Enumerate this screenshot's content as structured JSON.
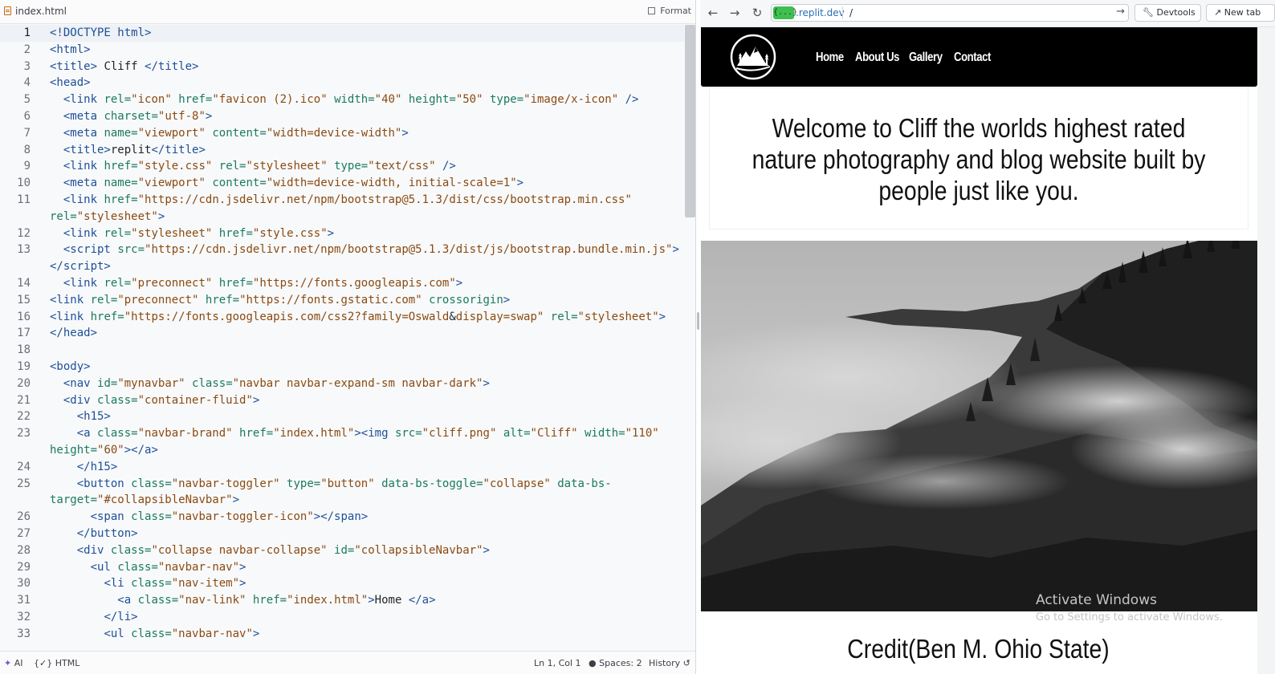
{
  "editor": {
    "tab_title": "index.html",
    "format_label": "Format",
    "lines": [
      {
        "n": "1",
        "html": "<span class='t'>&lt;!DOCTYPE html&gt;</span>"
      },
      {
        "n": "2",
        "html": "<span class='t'>&lt;html&gt;</span>"
      },
      {
        "n": "3",
        "html": "<span class='t'>&lt;title&gt;</span><span class='p'> Cliff </span><span class='t'>&lt;/title&gt;</span>"
      },
      {
        "n": "4",
        "html": "<span class='t'>&lt;head&gt;</span>"
      },
      {
        "n": "5",
        "html": "  <span class='t'>&lt;link</span> <span class='a'>rel=</span><span class='s'>\"icon\"</span> <span class='a'>href=</span><span class='s'>\"favicon (2).ico\"</span> <span class='a'>width=</span><span class='s'>\"40\"</span> <span class='a'>height=</span><span class='s'>\"50\"</span> <span class='a'>type=</span><span class='s'>\"image/x-icon\"</span> <span class='t'>/&gt;</span>"
      },
      {
        "n": "6",
        "html": "  <span class='t'>&lt;meta</span> <span class='a'>charset=</span><span class='s'>\"utf-8\"</span><span class='t'>&gt;</span>"
      },
      {
        "n": "7",
        "html": "  <span class='t'>&lt;meta</span> <span class='a'>name=</span><span class='s'>\"viewport\"</span> <span class='a'>content=</span><span class='s'>\"width=device-width\"</span><span class='t'>&gt;</span>"
      },
      {
        "n": "8",
        "html": "  <span class='t'>&lt;title&gt;</span><span class='p'>replit</span><span class='t'>&lt;/title&gt;</span>"
      },
      {
        "n": "9",
        "html": "  <span class='t'>&lt;link</span> <span class='a'>href=</span><span class='s'>\"style.css\"</span> <span class='a'>rel=</span><span class='s'>\"stylesheet\"</span> <span class='a'>type=</span><span class='s'>\"text/css\"</span> <span class='t'>/&gt;</span>"
      },
      {
        "n": "10",
        "html": "  <span class='t'>&lt;meta</span> <span class='a'>name=</span><span class='s'>\"viewport\"</span> <span class='a'>content=</span><span class='s'>\"width=device-width, initial-scale=1\"</span><span class='t'>&gt;</span>"
      },
      {
        "n": "11",
        "html": "  <span class='t'>&lt;link</span> <span class='a'>href=</span><span class='s'>\"https://cdn.jsdelivr.net/npm/bootstrap@5.1.3/dist/css/bootstrap.min.css\"</span>",
        "wrap": "<span class='a'>rel=</span><span class='s'>\"stylesheet\"</span><span class='t'>&gt;</span>"
      },
      {
        "n": "12",
        "html": "  <span class='t'>&lt;link</span> <span class='a'>rel=</span><span class='s'>\"stylesheet\"</span> <span class='a'>href=</span><span class='s'>\"style.css\"</span><span class='t'>&gt;</span>"
      },
      {
        "n": "13",
        "html": "  <span class='t'>&lt;script</span> <span class='a'>src=</span><span class='s'>\"https://cdn.jsdelivr.net/npm/bootstrap@5.1.3/dist/js/bootstrap.bundle.min.js\"</span><span class='t'>&gt;</span>",
        "wrap": "<span class='t'>&lt;/script&gt;</span>"
      },
      {
        "n": "14",
        "html": "  <span class='t'>&lt;link</span> <span class='a'>rel=</span><span class='s'>\"preconnect\"</span> <span class='a'>href=</span><span class='s'>\"https://fonts.googleapis.com\"</span><span class='t'>&gt;</span>"
      },
      {
        "n": "15",
        "html": "<span class='t'>&lt;link</span> <span class='a'>rel=</span><span class='s'>\"preconnect\"</span> <span class='a'>href=</span><span class='s'>\"https://fonts.gstatic.com\"</span> <span class='a'>crossorigin</span><span class='t'>&gt;</span>"
      },
      {
        "n": "16",
        "html": "<span class='t'>&lt;link</span> <span class='a'>href=</span><span class='s'>\"https://fonts.googleapis.com/css2?family=Oswald</span><span class='p'>&amp;</span><span class='s'>display=swap\"</span> <span class='a'>rel=</span><span class='s'>\"stylesheet\"</span><span class='t'>&gt;</span>"
      },
      {
        "n": "17",
        "html": "<span class='t'>&lt;/head&gt;</span>"
      },
      {
        "n": "18",
        "html": ""
      },
      {
        "n": "19",
        "html": "<span class='t'>&lt;body&gt;</span>"
      },
      {
        "n": "20",
        "html": "  <span class='t'>&lt;nav</span> <span class='a'>id=</span><span class='s'>\"mynavbar\"</span> <span class='a'>class=</span><span class='s'>\"navbar navbar-expand-sm navbar-dark\"</span><span class='t'>&gt;</span>"
      },
      {
        "n": "21",
        "html": "  <span class='t'>&lt;div</span> <span class='a'>class=</span><span class='s'>\"container-fluid\"</span><span class='t'>&gt;</span>"
      },
      {
        "n": "22",
        "html": "    <span class='t'>&lt;h15&gt;</span>"
      },
      {
        "n": "23",
        "html": "    <span class='t'>&lt;a</span> <span class='a'>class=</span><span class='s'>\"navbar-brand\"</span> <span class='a'>href=</span><span class='s'>\"index.html\"</span><span class='t'>&gt;&lt;img</span> <span class='a'>src=</span><span class='s'>\"cliff.png\"</span> <span class='a'>alt=</span><span class='s'>\"Cliff\"</span> <span class='a'>width=</span><span class='s'>\"110\"</span>",
        "wrap": "<span class='a'>height=</span><span class='s'>\"60\"</span><span class='t'>&gt;&lt;/a&gt;</span>"
      },
      {
        "n": "24",
        "html": "    <span class='t'>&lt;/h15&gt;</span>"
      },
      {
        "n": "25",
        "html": "    <span class='t'>&lt;button</span> <span class='a'>class=</span><span class='s'>\"navbar-toggler\"</span> <span class='a'>type=</span><span class='s'>\"button\"</span> <span class='a'>data-bs-toggle=</span><span class='s'>\"collapse\"</span> <span class='a'>data-bs-</span>",
        "wrap": "<span class='a'>target=</span><span class='s'>\"#collapsibleNavbar\"</span><span class='t'>&gt;</span>"
      },
      {
        "n": "26",
        "html": "      <span class='t'>&lt;span</span> <span class='a'>class=</span><span class='s'>\"navbar-toggler-icon\"</span><span class='t'>&gt;&lt;/span&gt;</span>"
      },
      {
        "n": "27",
        "html": "    <span class='t'>&lt;/button&gt;</span>"
      },
      {
        "n": "28",
        "html": "    <span class='t'>&lt;div</span> <span class='a'>class=</span><span class='s'>\"collapse navbar-collapse\"</span> <span class='a'>id=</span><span class='s'>\"collapsibleNavbar\"</span><span class='t'>&gt;</span>"
      },
      {
        "n": "29",
        "html": "      <span class='t'>&lt;ul</span> <span class='a'>class=</span><span class='s'>\"navbar-nav\"</span><span class='t'>&gt;</span>"
      },
      {
        "n": "30",
        "html": "        <span class='t'>&lt;li</span> <span class='a'>class=</span><span class='s'>\"nav-item\"</span><span class='t'>&gt;</span>"
      },
      {
        "n": "31",
        "html": "          <span class='t'>&lt;a</span> <span class='a'>class=</span><span class='s'>\"nav-link\"</span> <span class='a'>href=</span><span class='s'>\"index.html\"</span><span class='t'>&gt;</span><span class='p'>Home </span><span class='t'>&lt;/a&gt;</span>"
      },
      {
        "n": "32",
        "html": "        <span class='t'>&lt;/li&gt;</span>"
      },
      {
        "n": "33",
        "html": "        <span class='t'>&lt;ul</span> <span class='a'>class=</span><span class='s'>\"navbar-nav\"</span><span class='t'>&gt;</span>"
      }
    ],
    "status": {
      "ai": "AI",
      "lang": "HTML",
      "position": "Ln 1, Col 1",
      "spaces": "Spaces: 2",
      "history": "History"
    }
  },
  "browser": {
    "url_badge": "{...}",
    "url_domain": ".replit.dev",
    "url_path": "/",
    "devtools_label": "Devtools",
    "new_tab_label": "New tab"
  },
  "site": {
    "nav_links": [
      "Home",
      "About Us",
      "Gallery",
      "Contact"
    ],
    "hero_heading": "Welcome to Cliff the worlds highest rated nature photography and blog website built by people just like you.",
    "credit": "Credit(Ben M. Ohio State)"
  },
  "os_watermark": {
    "title": "Activate Windows",
    "subtitle": "Go to Settings to activate Windows."
  },
  "colors": {
    "tag": "#1d4f99",
    "attribute": "#1a7a5e",
    "string": "#8a4a12",
    "url_badge": "#3fbf4f",
    "navbar": "#000000"
  }
}
